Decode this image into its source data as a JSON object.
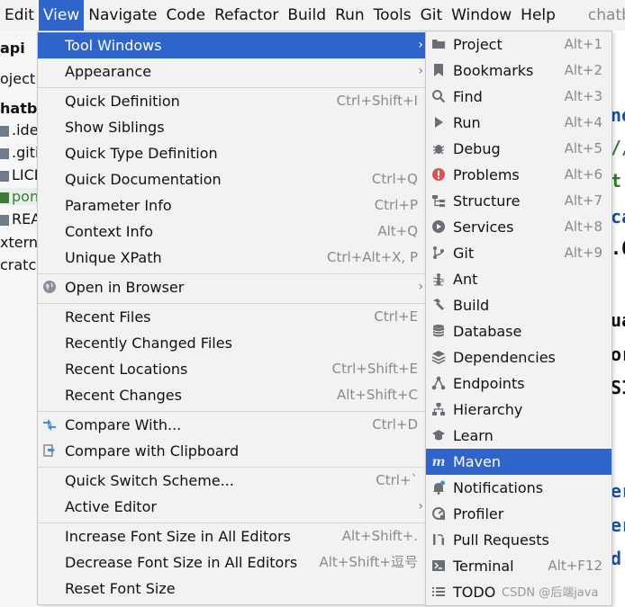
{
  "menubar": {
    "items": [
      "Edit",
      "View",
      "Navigate",
      "Code",
      "Refactor",
      "Build",
      "Run",
      "Tools",
      "Git",
      "Window",
      "Help"
    ],
    "active": "View",
    "app_name": "chatb"
  },
  "project_panel": {
    "breadcrumb": "api",
    "tab": "oject",
    "root": "hatbo",
    "files": [
      ".ide",
      ".giti",
      "LICE",
      "pon",
      "REA"
    ],
    "externa": "xterna",
    "scratch": "cratch"
  },
  "editor_fragments": [
    "ne",
    "//",
    "t",
    "ca",
    ".0",
    "ua",
    "or",
    "SI",
    "er",
    "er",
    "d"
  ],
  "view_menu": {
    "items": [
      {
        "label": "Tool Windows",
        "shortcut": "",
        "submenu": true,
        "selected": true
      },
      {
        "label": "Appearance",
        "shortcut": "",
        "submenu": true
      },
      {
        "label": "Quick Definition",
        "shortcut": "Ctrl+Shift+I"
      },
      {
        "label": "Show Siblings",
        "shortcut": ""
      },
      {
        "label": "Quick Type Definition",
        "shortcut": ""
      },
      {
        "label": "Quick Documentation",
        "shortcut": "Ctrl+Q"
      },
      {
        "label": "Parameter Info",
        "shortcut": "Ctrl+P"
      },
      {
        "label": "Context Info",
        "shortcut": "Alt+Q"
      },
      {
        "label": "Unique XPath",
        "shortcut": "Ctrl+Alt+X, P"
      },
      {
        "label": "Open in Browser",
        "shortcut": "",
        "submenu": true,
        "icon": "globe-icon"
      },
      {
        "label": "Recent Files",
        "shortcut": "Ctrl+E"
      },
      {
        "label": "Recently Changed Files",
        "shortcut": ""
      },
      {
        "label": "Recent Locations",
        "shortcut": "Ctrl+Shift+E"
      },
      {
        "label": "Recent Changes",
        "shortcut": "Alt+Shift+C"
      },
      {
        "label": "Compare With...",
        "shortcut": "Ctrl+D",
        "icon": "compare-icon"
      },
      {
        "label": "Compare with Clipboard",
        "shortcut": "",
        "icon": "compare-clipboard-icon"
      },
      {
        "label": "Quick Switch Scheme...",
        "shortcut": "Ctrl+`"
      },
      {
        "label": "Active Editor",
        "shortcut": "",
        "submenu": true
      },
      {
        "label": "Increase Font Size in All Editors",
        "shortcut": "Alt+Shift+."
      },
      {
        "label": "Decrease Font Size in All Editors",
        "shortcut": "Alt+Shift+逗号"
      },
      {
        "label": "Reset Font Size",
        "shortcut": ""
      }
    ]
  },
  "tool_windows_menu": {
    "items": [
      {
        "label": "Project",
        "shortcut": "Alt+1",
        "icon": "folder-icon"
      },
      {
        "label": "Bookmarks",
        "shortcut": "Alt+2",
        "icon": "bookmark-icon"
      },
      {
        "label": "Find",
        "shortcut": "Alt+3",
        "icon": "search-icon"
      },
      {
        "label": "Run",
        "shortcut": "Alt+4",
        "icon": "run-icon"
      },
      {
        "label": "Debug",
        "shortcut": "Alt+5",
        "icon": "bug-icon"
      },
      {
        "label": "Problems",
        "shortcut": "Alt+6",
        "icon": "error-icon"
      },
      {
        "label": "Structure",
        "shortcut": "Alt+7",
        "icon": "structure-icon"
      },
      {
        "label": "Services",
        "shortcut": "Alt+8",
        "icon": "services-icon"
      },
      {
        "label": "Git",
        "shortcut": "Alt+9",
        "icon": "git-icon"
      },
      {
        "label": "Ant",
        "shortcut": "",
        "icon": "ant-icon"
      },
      {
        "label": "Build",
        "shortcut": "",
        "icon": "hammer-icon"
      },
      {
        "label": "Database",
        "shortcut": "",
        "icon": "database-icon"
      },
      {
        "label": "Dependencies",
        "shortcut": "",
        "icon": "dependencies-icon"
      },
      {
        "label": "Endpoints",
        "shortcut": "",
        "icon": "endpoints-icon"
      },
      {
        "label": "Hierarchy",
        "shortcut": "",
        "icon": "hierarchy-icon"
      },
      {
        "label": "Learn",
        "shortcut": "",
        "icon": "learn-icon"
      },
      {
        "label": "Maven",
        "shortcut": "",
        "icon": "maven-icon",
        "selected": true
      },
      {
        "label": "Notifications",
        "shortcut": "",
        "icon": "bell-icon"
      },
      {
        "label": "Profiler",
        "shortcut": "",
        "icon": "profiler-icon"
      },
      {
        "label": "Pull Requests",
        "shortcut": "",
        "icon": "pull-requests-icon"
      },
      {
        "label": "Terminal",
        "shortcut": "Alt+F12",
        "icon": "terminal-icon"
      },
      {
        "label": "TODO",
        "shortcut": "",
        "icon": "todo-icon"
      }
    ]
  },
  "watermark": "CSDN @后端java",
  "colors": {
    "selection": "#2f65ca",
    "menu_bg": "#f2f2f2",
    "shortcut": "#8a8a8a"
  }
}
